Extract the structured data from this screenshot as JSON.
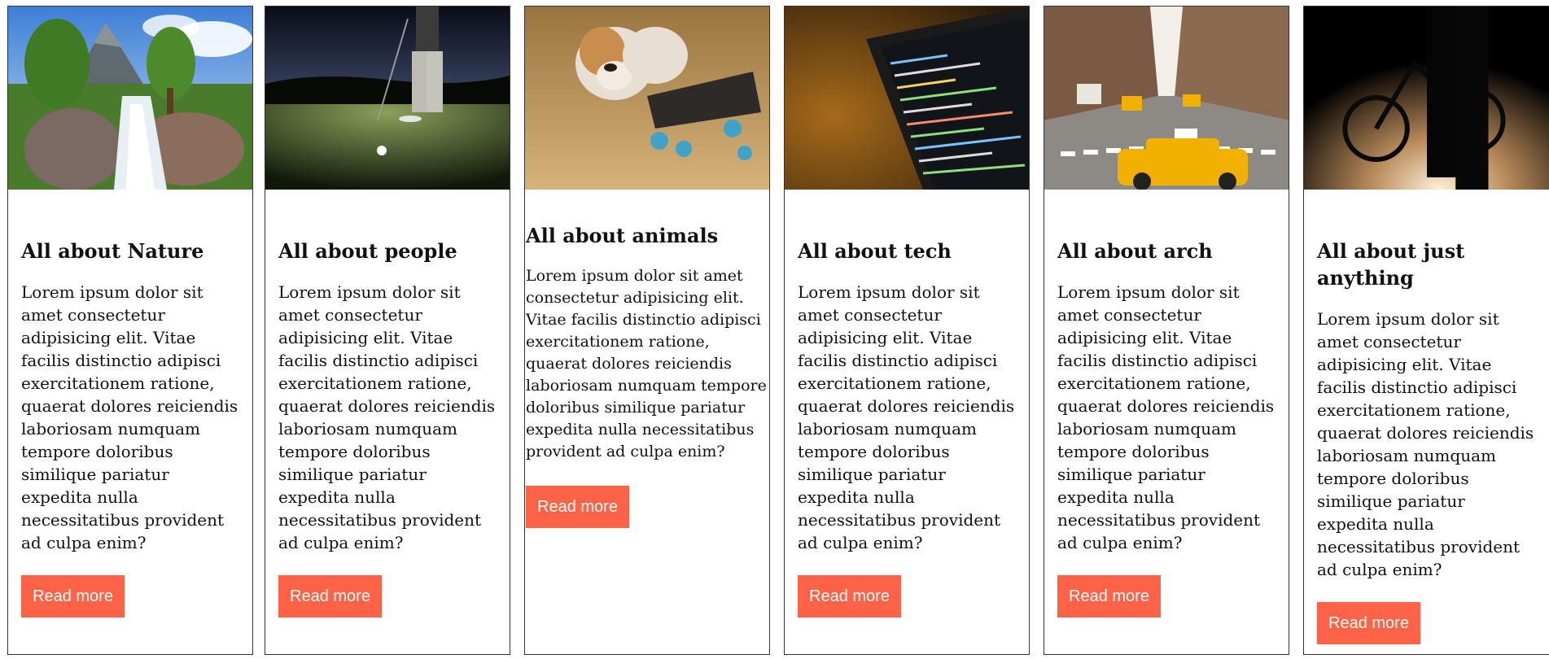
{
  "cards": [
    {
      "image": "mountain-waterfall-photo",
      "title": "All about Nature",
      "text": "Lorem ipsum dolor sit amet consectetur adipisicing elit. Vitae facilis distinctio adipisci exercitationem ratione, quaerat dolores reiciendis laboriosam numquam tempore doloribus similique pariatur expedita nulla necessitatibus provident ad culpa enim?",
      "button": "Read more"
    },
    {
      "image": "golfer-putting-photo",
      "title": "All about people",
      "text": "Lorem ipsum dolor sit amet consectetur adipisicing elit. Vitae facilis distinctio adipisci exercitationem ratione, quaerat dolores reiciendis laboriosam numquam tempore doloribus similique pariatur expedita nulla necessitatibus provident ad culpa enim?",
      "button": "Read more"
    },
    {
      "image": "puppy-skateboard-photo",
      "title": "All about animals",
      "text": "Lorem ipsum dolor sit amet consectetur adipisicing elit. Vitae facilis distinctio adipisci exercitationem ratione, quaerat dolores reiciendis laboriosam numquam tempore doloribus similique pariatur expedita nulla necessitatibus provident ad culpa enim?",
      "button": "Read more"
    },
    {
      "image": "laptop-code-photo",
      "title": "All about tech",
      "text": "Lorem ipsum dolor sit amet consectetur adipisicing elit. Vitae facilis distinctio adipisci exercitationem ratione, quaerat dolores reiciendis laboriosam numquam tempore doloribus similique pariatur expedita nulla necessitatibus provident ad culpa enim?",
      "button": "Read more"
    },
    {
      "image": "city-street-taxi-photo",
      "title": "All about arch",
      "text": "Lorem ipsum dolor sit amet consectetur adipisicing elit. Vitae facilis distinctio adipisci exercitationem ratione, quaerat dolores reiciendis laboriosam numquam tempore doloribus similique pariatur expedita nulla necessitatibus provident ad culpa enim?",
      "button": "Read more"
    },
    {
      "image": "bicycle-silhouette-photo",
      "title": "All about just anything",
      "text": "Lorem ipsum dolor sit amet consectetur adipisicing elit. Vitae facilis distinctio adipisci exercitationem ratione, quaerat dolores reiciendis laboriosam numquam tempore doloribus similique pariatur expedita nulla necessitatibus provident ad culpa enim?",
      "button": "Read more"
    }
  ],
  "colors": {
    "accent": "#ff6347",
    "border": "#333333",
    "text": "#111111"
  }
}
